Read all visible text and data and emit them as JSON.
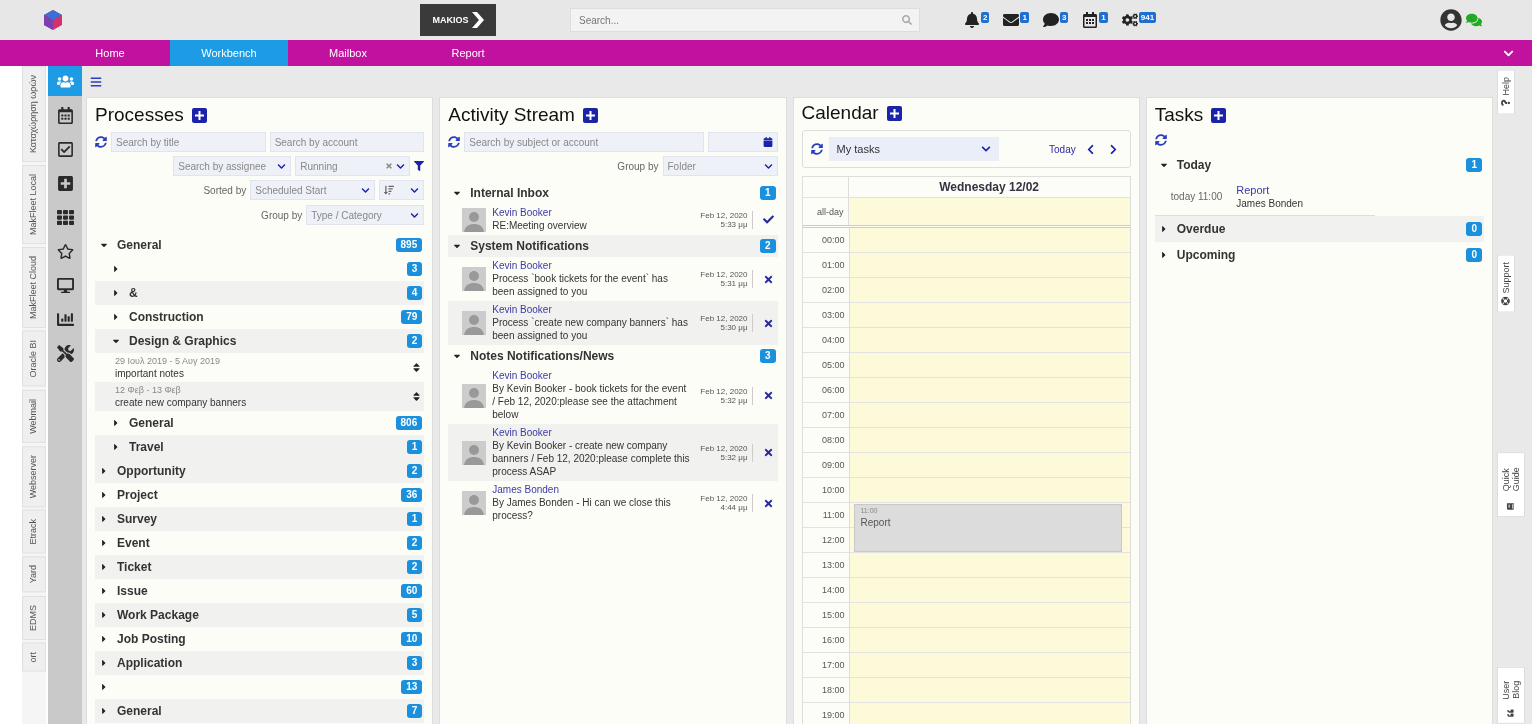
{
  "topbar": {
    "brand": "MAKIOS",
    "search_placeholder": "Search...",
    "notifications": [
      {
        "kind": "bell",
        "count": "2"
      },
      {
        "kind": "mail",
        "count": "1"
      },
      {
        "kind": "chat",
        "count": "3"
      },
      {
        "kind": "calendar",
        "count": "1"
      },
      {
        "kind": "gears",
        "count": "941"
      }
    ]
  },
  "nav": {
    "tabs": [
      {
        "label": "Home",
        "selected": false
      },
      {
        "label": "Workbench",
        "selected": true
      },
      {
        "label": "Mailbox",
        "selected": false
      },
      {
        "label": "Report",
        "selected": false
      }
    ]
  },
  "left_tabs": [
    "Καταχώρηση ωρών",
    "MakFleet Local",
    "MakFleet Cloud",
    "Oracle BI",
    "Webmail",
    "Webserver",
    "Etrack",
    "Yard",
    "EDMS",
    "ort"
  ],
  "tools": [
    {
      "kind": "users",
      "selected": true
    },
    {
      "kind": "calendar",
      "selected": false
    },
    {
      "kind": "check",
      "selected": false
    },
    {
      "kind": "plus",
      "selected": false
    },
    {
      "kind": "grid",
      "selected": false
    },
    {
      "kind": "star",
      "selected": false
    },
    {
      "kind": "screen",
      "selected": false
    },
    {
      "kind": "chart",
      "selected": false
    },
    {
      "kind": "tools",
      "selected": false
    }
  ],
  "processes": {
    "title": "Processes",
    "search_title_placeholder": "Search by title",
    "search_account_placeholder": "Search by account",
    "assignee_placeholder": "Search by assignee",
    "status_value": "Running",
    "sorted_by_label": "Sorted by",
    "sorted_by_value": "Scheduled Start",
    "group_by_label": "Group by",
    "group_by_placeholder": "Type / Category",
    "tree": [
      {
        "kind": "group",
        "label": "General",
        "count": "895",
        "expanded": true,
        "children": [
          {
            "kind": "group",
            "count": "3",
            "expanded": false
          },
          {
            "kind": "group",
            "label": "&",
            "count": "4",
            "expanded": false
          },
          {
            "kind": "group",
            "label": "Construction",
            "count": "79",
            "expanded": false
          },
          {
            "kind": "group",
            "label": "Design & Graphics",
            "count": "2",
            "expanded": true,
            "children": [
              {
                "kind": "note",
                "dates": "29 Ιουλ 2019 - 5 Αυγ 2019",
                "title": "important notes"
              },
              {
                "kind": "note",
                "dates": "12 Φεβ - 13 Φεβ",
                "title": "create new company banners"
              }
            ]
          },
          {
            "kind": "group",
            "label": "General",
            "count": "806",
            "expanded": false
          },
          {
            "kind": "group",
            "label": "Travel",
            "count": "1",
            "expanded": false
          }
        ]
      },
      {
        "kind": "group",
        "label": "Opportunity",
        "count": "2",
        "expanded": false
      },
      {
        "kind": "group",
        "label": "Project",
        "count": "36",
        "expanded": false
      },
      {
        "kind": "group",
        "label": "Survey",
        "count": "1",
        "expanded": false
      },
      {
        "kind": "group",
        "label": "Event",
        "count": "2",
        "expanded": false
      },
      {
        "kind": "group",
        "label": "Ticket",
        "count": "2",
        "expanded": false
      },
      {
        "kind": "group",
        "label": "Issue",
        "count": "60",
        "expanded": false
      },
      {
        "kind": "group",
        "label": "Work Package",
        "count": "5",
        "expanded": false
      },
      {
        "kind": "group",
        "label": "Job Posting",
        "count": "10",
        "expanded": false
      },
      {
        "kind": "group",
        "label": "Application",
        "count": "3",
        "expanded": false
      },
      {
        "kind": "group",
        "count": "13",
        "expanded": false
      },
      {
        "kind": "group",
        "label": "General",
        "count": "7",
        "expanded": false
      }
    ]
  },
  "activity": {
    "title": "Activity Stream",
    "search_placeholder": "Search by subject or account",
    "group_by_label": "Group by",
    "group_by_placeholder": "Folder",
    "groups": [
      {
        "label": "Internal Inbox",
        "count": "1",
        "expanded": true,
        "items": [
          {
            "author": "Kevin Booker",
            "text": "RE:Meeting overview",
            "date": "Feb 12, 2020",
            "time": "5:33 μμ",
            "kind": "check"
          }
        ]
      },
      {
        "label": "System Notifications",
        "count": "2",
        "expanded": true,
        "items": [
          {
            "author": "Kevin Booker",
            "text": "Process `book tickets for the event` has been assigned to you",
            "date": "Feb 12, 2020",
            "time": "5:31 μμ",
            "kind": "close"
          },
          {
            "author": "Kevin Booker",
            "text": "Process `create new company banners` has been assigned to you",
            "date": "Feb 12, 2020",
            "time": "5:30 μμ",
            "kind": "close"
          }
        ]
      },
      {
        "label": "Notes Notifications/News",
        "count": "3",
        "expanded": true,
        "items": [
          {
            "author": "Kevin Booker",
            "text": "By Kevin Booker - book tickets for the event / Feb 12, 2020:please see the attachment below",
            "date": "Feb 12, 2020",
            "time": "5:32 μμ",
            "kind": "close"
          },
          {
            "author": "Kevin Booker",
            "text": "By Kevin Booker - create new company banners / Feb 12, 2020:please complete this process ASAP",
            "date": "Feb 12, 2020",
            "time": "5:32 μμ",
            "kind": "close"
          },
          {
            "author": "James Bonden",
            "text": "By James Bonden - Hi can we close this process?",
            "date": "Feb 12, 2020",
            "time": "4:44 μμ",
            "kind": "close"
          }
        ]
      }
    ]
  },
  "calendar": {
    "title": "Calendar",
    "view_value": "My tasks",
    "today_label": "Today",
    "day_header": "Wednesday 12/02",
    "allday_label": "all-day",
    "hours": [
      {
        "label": "00:00"
      },
      {
        "label": "01:00"
      },
      {
        "label": "02:00"
      },
      {
        "label": "03:00"
      },
      {
        "label": "04:00"
      },
      {
        "label": "05:00"
      },
      {
        "label": "06:00"
      },
      {
        "label": "07:00"
      },
      {
        "label": "08:00"
      },
      {
        "label": "09:00"
      },
      {
        "label": "10:00"
      },
      {
        "label": "11:00",
        "event": {
          "time": "11:00",
          "title": "Report"
        }
      },
      {
        "label": "12:00"
      },
      {
        "label": "13:00"
      },
      {
        "label": "14:00"
      },
      {
        "label": "15:00"
      },
      {
        "label": "16:00"
      },
      {
        "label": "17:00"
      },
      {
        "label": "18:00"
      },
      {
        "label": "19:00"
      }
    ]
  },
  "tasks": {
    "title": "Tasks",
    "groups": [
      {
        "label": "Today",
        "count": "1",
        "expanded": true,
        "items": [
          {
            "when": "today 11:00",
            "title": "Report",
            "person": "James Bonden"
          }
        ]
      },
      {
        "label": "Overdue",
        "count": "0",
        "expanded": false
      },
      {
        "label": "Upcoming",
        "count": "0",
        "expanded": false
      }
    ]
  },
  "right_tabs": [
    {
      "kind": "help",
      "label": "Help"
    },
    {
      "kind": "support",
      "label": "Support"
    },
    {
      "kind": "guide",
      "label": "Quick Guide"
    },
    {
      "kind": "blog",
      "label": "User Blog"
    }
  ]
}
